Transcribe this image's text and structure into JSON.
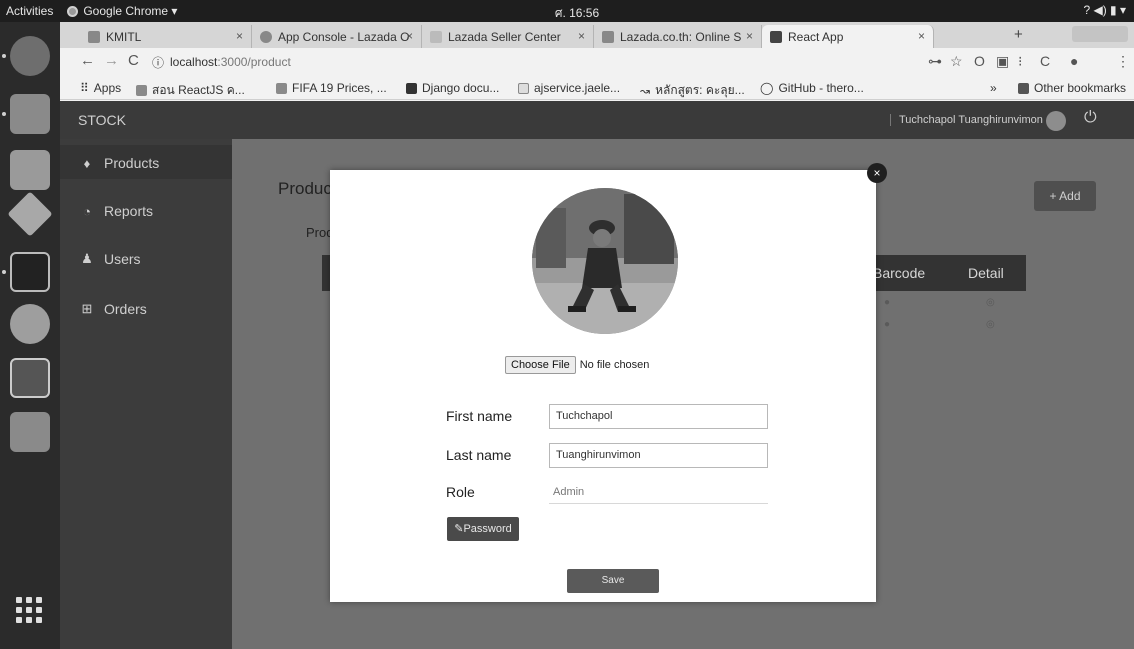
{
  "topbar": {
    "activities": "Activities",
    "app_name": "Google Chrome ▾",
    "clock": "ศ. 16:56",
    "status_icons": "? ◀) ▮ ▾"
  },
  "browser": {
    "tabs": [
      {
        "label": "KMITL"
      },
      {
        "label": "App Console - Lazada O"
      },
      {
        "label": "Lazada Seller Center"
      },
      {
        "label": "Lazada.co.th: Online S"
      },
      {
        "label": "React App"
      }
    ],
    "url_host": "localhost",
    "url_path": ":3000/product",
    "bookmarks": [
      {
        "label": "Apps"
      },
      {
        "label": "สอน ReactJS ค..."
      },
      {
        "label": "FIFA 19 Prices, ..."
      },
      {
        "label": "Django docu..."
      },
      {
        "label": "ajservice.jaele..."
      },
      {
        "label": "หลักสูตร: คะลุย..."
      },
      {
        "label": "GitHub - thero..."
      },
      {
        "label": "Other bookmarks"
      }
    ]
  },
  "app": {
    "brand": "STOCK",
    "user_name": "Tuchchapol Tuanghirunvimon",
    "sidebar": [
      {
        "label": "Products",
        "icon": "tag-icon"
      },
      {
        "label": "Reports",
        "icon": "pie-icon"
      },
      {
        "label": "Users",
        "icon": "users-icon"
      },
      {
        "label": "Orders",
        "icon": "cart-icon"
      }
    ],
    "page_title": "Produc",
    "page_subtitle": "Prod",
    "add_button": "+ Add",
    "table_headers": {
      "barcode": "Barcode",
      "detail": "Detail"
    }
  },
  "modal": {
    "choose_file": "Choose File",
    "no_file": "No file chosen",
    "first_name_label": "First name",
    "first_name_value": "Tuchchapol",
    "last_name_label": "Last name",
    "last_name_value": "Tuanghirunvimon",
    "role_label": "Role",
    "role_value": "Admin",
    "password_button": "Password",
    "save_button": "Save",
    "close": "×"
  }
}
